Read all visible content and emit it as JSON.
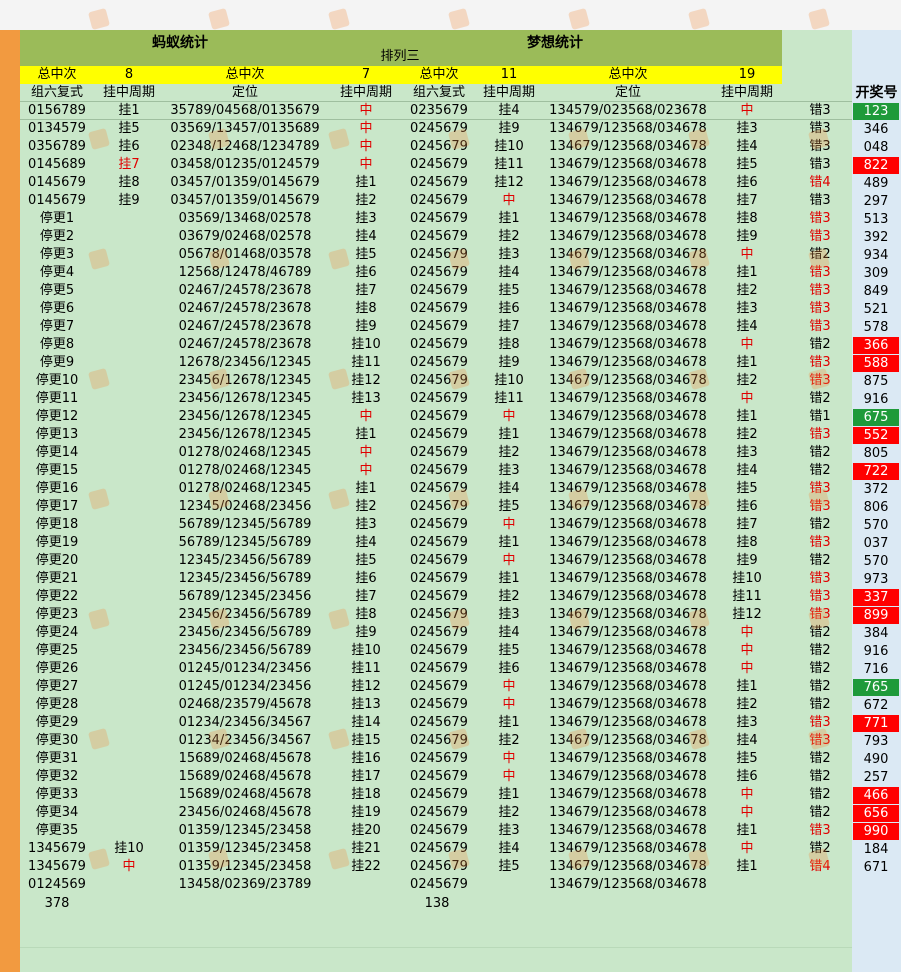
{
  "header": {
    "ant_title": "蚂蚁统计",
    "dream_title": "梦想统计",
    "subtitle": "排列三",
    "total_label_1": "总中次",
    "total_val_1": "8",
    "total_label_2": "总中次",
    "total_val_2": "7",
    "total_label_3": "总中次",
    "total_val_3": "11",
    "total_label_4": "总中次",
    "total_val_4": "19"
  },
  "columns": {
    "c1": "组六复式",
    "c2": "挂中周期",
    "c3": "定位",
    "c4": "挂中周期",
    "c5": "组六复式",
    "c6": "挂中周期",
    "c7": "定位",
    "c8": "挂中周期",
    "c10": "开奖号"
  },
  "rows": [
    [
      "0156789",
      "挂1",
      "35789/04568/0135679",
      "中",
      "0235679",
      "挂4",
      "134579/023568/023678",
      "中",
      "错3",
      "123"
    ],
    [
      "0134579",
      "挂5",
      "03569/13457/0135689",
      "中",
      "0245679",
      "挂9",
      "134679/123568/034678",
      "挂3",
      "错3",
      "346"
    ],
    [
      "0356789",
      "挂6",
      "02348/12468/1234789",
      "中",
      "0245679",
      "挂10",
      "134679/123568/034678",
      "挂4",
      "错3",
      "048"
    ],
    [
      "0145689",
      "挂7",
      "03458/01235/0124579",
      "中",
      "0245679",
      "挂11",
      "134679/123568/034678",
      "挂5",
      "错3",
      "822"
    ],
    [
      "0145679",
      "挂8",
      "03457/01359/0145679",
      "挂1",
      "0245679",
      "挂12",
      "134679/123568/034678",
      "挂6",
      "错4",
      "489"
    ],
    [
      "0145679",
      "挂9",
      "03457/01359/0145679",
      "挂2",
      "0245679",
      "中",
      "134679/123568/034678",
      "挂7",
      "错3",
      "297"
    ],
    [
      "停更1",
      "",
      "03569/13468/02578",
      "挂3",
      "0245679",
      "挂1",
      "134679/123568/034678",
      "挂8",
      "错3",
      "513"
    ],
    [
      "停更2",
      "",
      "03679/02468/02578",
      "挂4",
      "0245679",
      "挂2",
      "134679/123568/034678",
      "挂9",
      "错3",
      "392"
    ],
    [
      "停更3",
      "",
      "05678/01468/03578",
      "挂5",
      "0245679",
      "挂3",
      "134679/123568/034678",
      "中",
      "错2",
      "934"
    ],
    [
      "停更4",
      "",
      "12568/12478/46789",
      "挂6",
      "0245679",
      "挂4",
      "134679/123568/034678",
      "挂1",
      "错3",
      "309"
    ],
    [
      "停更5",
      "",
      "02467/24578/23678",
      "挂7",
      "0245679",
      "挂5",
      "134679/123568/034678",
      "挂2",
      "错3",
      "849"
    ],
    [
      "停更6",
      "",
      "02467/24578/23678",
      "挂8",
      "0245679",
      "挂6",
      "134679/123568/034678",
      "挂3",
      "错3",
      "521"
    ],
    [
      "停更7",
      "",
      "02467/24578/23678",
      "挂9",
      "0245679",
      "挂7",
      "134679/123568/034678",
      "挂4",
      "错3",
      "578"
    ],
    [
      "停更8",
      "",
      "02467/24578/23678",
      "挂10",
      "0245679",
      "挂8",
      "134679/123568/034678",
      "中",
      "错2",
      "366"
    ],
    [
      "停更9",
      "",
      "12678/23456/12345",
      "挂11",
      "0245679",
      "挂9",
      "134679/123568/034678",
      "挂1",
      "错3",
      "588"
    ],
    [
      "停更10",
      "",
      "23456/12678/12345",
      "挂12",
      "0245679",
      "挂10",
      "134679/123568/034678",
      "挂2",
      "错3",
      "875"
    ],
    [
      "停更11",
      "",
      "23456/12678/12345",
      "挂13",
      "0245679",
      "挂11",
      "134679/123568/034678",
      "中",
      "错2",
      "916"
    ],
    [
      "停更12",
      "",
      "23456/12678/12345",
      "中",
      "0245679",
      "中",
      "134679/123568/034678",
      "挂1",
      "错1",
      "675"
    ],
    [
      "停更13",
      "",
      "23456/12678/12345",
      "挂1",
      "0245679",
      "挂1",
      "134679/123568/034678",
      "挂2",
      "错3",
      "552"
    ],
    [
      "停更14",
      "",
      "01278/02468/12345",
      "中",
      "0245679",
      "挂2",
      "134679/123568/034678",
      "挂3",
      "错2",
      "805"
    ],
    [
      "停更15",
      "",
      "01278/02468/12345",
      "中",
      "0245679",
      "挂3",
      "134679/123568/034678",
      "挂4",
      "错2",
      "722"
    ],
    [
      "停更16",
      "",
      "01278/02468/12345",
      "挂1",
      "0245679",
      "挂4",
      "134679/123568/034678",
      "挂5",
      "错3",
      "372"
    ],
    [
      "停更17",
      "",
      "12345/02468/23456",
      "挂2",
      "0245679",
      "挂5",
      "134679/123568/034678",
      "挂6",
      "错3",
      "806"
    ],
    [
      "停更18",
      "",
      "56789/12345/56789",
      "挂3",
      "0245679",
      "中",
      "134679/123568/034678",
      "挂7",
      "错2",
      "570"
    ],
    [
      "停更19",
      "",
      "56789/12345/56789",
      "挂4",
      "0245679",
      "挂1",
      "134679/123568/034678",
      "挂8",
      "错3",
      "037"
    ],
    [
      "停更20",
      "",
      "12345/23456/56789",
      "挂5",
      "0245679",
      "中",
      "134679/123568/034678",
      "挂9",
      "错2",
      "570"
    ],
    [
      "停更21",
      "",
      "12345/23456/56789",
      "挂6",
      "0245679",
      "挂1",
      "134679/123568/034678",
      "挂10",
      "错3",
      "973"
    ],
    [
      "停更22",
      "",
      "56789/12345/23456",
      "挂7",
      "0245679",
      "挂2",
      "134679/123568/034678",
      "挂11",
      "错3",
      "337"
    ],
    [
      "停更23",
      "",
      "23456/23456/56789",
      "挂8",
      "0245679",
      "挂3",
      "134679/123568/034678",
      "挂12",
      "错3",
      "899"
    ],
    [
      "停更24",
      "",
      "23456/23456/56789",
      "挂9",
      "0245679",
      "挂4",
      "134679/123568/034678",
      "中",
      "错2",
      "384"
    ],
    [
      "停更25",
      "",
      "23456/23456/56789",
      "挂10",
      "0245679",
      "挂5",
      "134679/123568/034678",
      "中",
      "错2",
      "916"
    ],
    [
      "停更26",
      "",
      "01245/01234/23456",
      "挂11",
      "0245679",
      "挂6",
      "134679/123568/034678",
      "中",
      "错2",
      "716"
    ],
    [
      "停更27",
      "",
      "01245/01234/23456",
      "挂12",
      "0245679",
      "中",
      "134679/123568/034678",
      "挂1",
      "错2",
      "765"
    ],
    [
      "停更28",
      "",
      "02468/23579/45678",
      "挂13",
      "0245679",
      "中",
      "134679/123568/034678",
      "挂2",
      "错2",
      "672"
    ],
    [
      "停更29",
      "",
      "01234/23456/34567",
      "挂14",
      "0245679",
      "挂1",
      "134679/123568/034678",
      "挂3",
      "错3",
      "771"
    ],
    [
      "停更30",
      "",
      "01234/23456/34567",
      "挂15",
      "0245679",
      "挂2",
      "134679/123568/034678",
      "挂4",
      "错3",
      "793"
    ],
    [
      "停更31",
      "",
      "15689/02468/45678",
      "挂16",
      "0245679",
      "中",
      "134679/123568/034678",
      "挂5",
      "错2",
      "490"
    ],
    [
      "停更32",
      "",
      "15689/02468/45678",
      "挂17",
      "0245679",
      "中",
      "134679/123568/034678",
      "挂6",
      "错2",
      "257"
    ],
    [
      "停更33",
      "",
      "15689/02468/45678",
      "挂18",
      "0245679",
      "挂1",
      "134679/123568/034678",
      "中",
      "错2",
      "466"
    ],
    [
      "停更34",
      "",
      "23456/02468/45678",
      "挂19",
      "0245679",
      "挂2",
      "134679/123568/034678",
      "中",
      "错2",
      "656"
    ],
    [
      "停更35",
      "",
      "01359/12345/23458",
      "挂20",
      "0245679",
      "挂3",
      "134679/123568/034678",
      "挂1",
      "错3",
      "990"
    ],
    [
      "1345679",
      "挂10",
      "01359/12345/23458",
      "挂21",
      "0245679",
      "挂4",
      "134679/123568/034678",
      "中",
      "错2",
      "184"
    ],
    [
      "1345679",
      "中",
      "01359/12345/23458",
      "挂22",
      "0245679",
      "挂5",
      "134679/123568/034678",
      "挂1",
      "错4",
      "671"
    ],
    [
      "0124569",
      "",
      "13458/02369/23789",
      "",
      "0245679",
      "",
      "134679/123568/034678",
      "",
      "",
      ""
    ]
  ],
  "footer": {
    "ant_total": "378",
    "dream_total": "138"
  },
  "highlights": {
    "red_results": [
      3,
      13,
      14,
      18,
      20,
      27,
      28,
      34,
      38,
      39,
      40
    ],
    "green_results": [
      0,
      17,
      32
    ],
    "red_errors": [
      4,
      6,
      7,
      9,
      10,
      11,
      12,
      14,
      15,
      18,
      21,
      22,
      24,
      26,
      27,
      28,
      34,
      35,
      40,
      42
    ]
  },
  "colors": {
    "olive": "#9bbb59",
    "yellow": "#ffff00",
    "orange": "#f29a40",
    "sheet_green": "#c9e7c9",
    "red": "#ff0000",
    "green": "#1e9a3a"
  }
}
